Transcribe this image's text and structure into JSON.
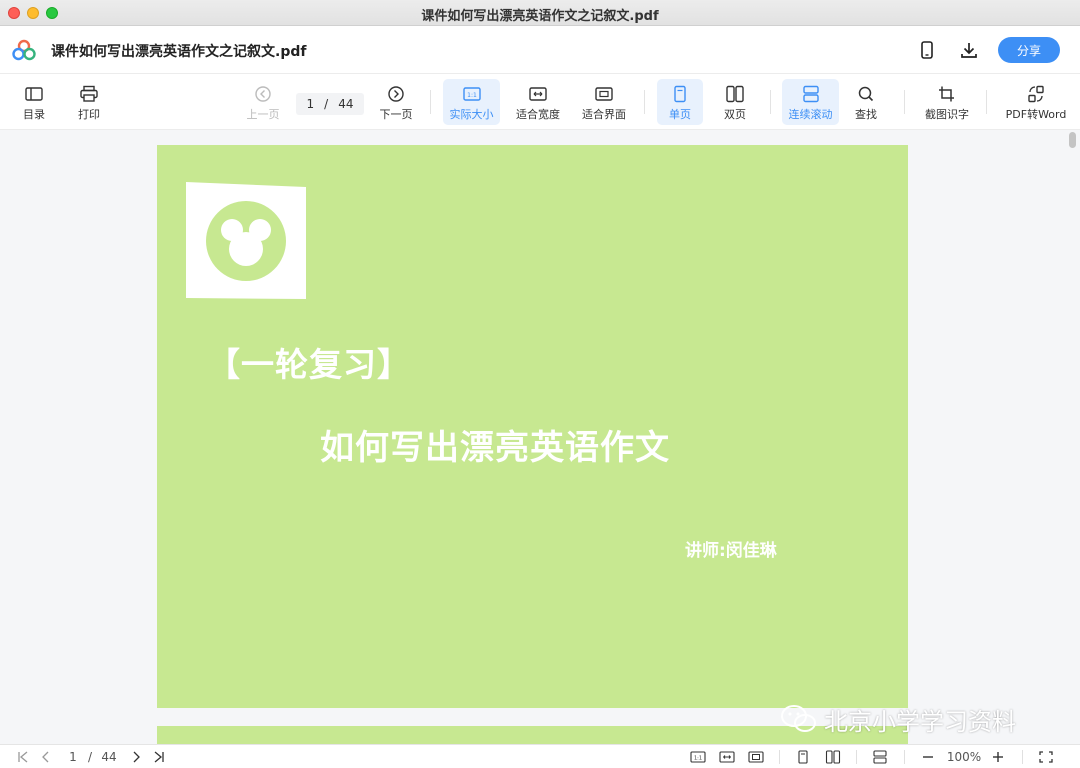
{
  "window": {
    "title": "课件如何写出漂亮英语作文之记叙文.pdf"
  },
  "header": {
    "doc_title": "课件如何写出漂亮英语作文之记叙文.pdf",
    "share_label": "分享"
  },
  "toolbar": {
    "toc": "目录",
    "print": "打印",
    "prev_page": "上一页",
    "current_page": "1",
    "page_sep": "/",
    "total_pages": "44",
    "next_page": "下一页",
    "actual_size": "实际大小",
    "fit_width": "适合宽度",
    "fit_window": "适合界面",
    "single_page": "单页",
    "double_page": "双页",
    "continuous_scroll": "连续滚动",
    "find": "查找",
    "screenshot_ocr": "截图识字",
    "pdf_to_word": "PDF转Word"
  },
  "document": {
    "heading": "【一轮复习】",
    "title": "如何写出漂亮英语作文",
    "speaker": "讲师:闵佳琳",
    "page_color": "#c7e891"
  },
  "watermark": {
    "text": "北京小学学习资料"
  },
  "statusbar": {
    "current_page": "1",
    "page_sep": "/",
    "total_pages": "44",
    "zoom": "100%"
  },
  "colors": {
    "accent": "#3d8ff5",
    "page_bg": "#c7e891"
  }
}
